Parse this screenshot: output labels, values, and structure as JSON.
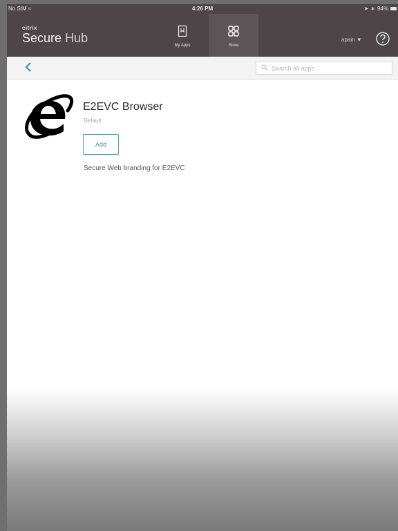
{
  "status_bar": {
    "carrier": "No SIM",
    "time": "4:26 PM",
    "battery": "94%"
  },
  "header": {
    "brand_small": "citrix",
    "brand_title_bold": "Secure",
    "brand_title_light": "Hub",
    "tabs": [
      {
        "label": "My Apps",
        "icon": "bookmark-icon",
        "active": false
      },
      {
        "label": "Store",
        "icon": "grid-icon",
        "active": true
      }
    ],
    "user": "apain",
    "help_icon": "question-circle-icon"
  },
  "toolbar": {
    "back_icon": "chevron-left-icon",
    "search_placeholder": "Search all apps"
  },
  "app": {
    "name": "E2EVC Browser",
    "category": "Default",
    "add_label": "Add",
    "description": "Secure Web branding for E2EVC",
    "logo_icon": "internet-explorer-logo"
  },
  "colors": {
    "header_bg": "#4e4549",
    "accent": "#3a98a6"
  }
}
